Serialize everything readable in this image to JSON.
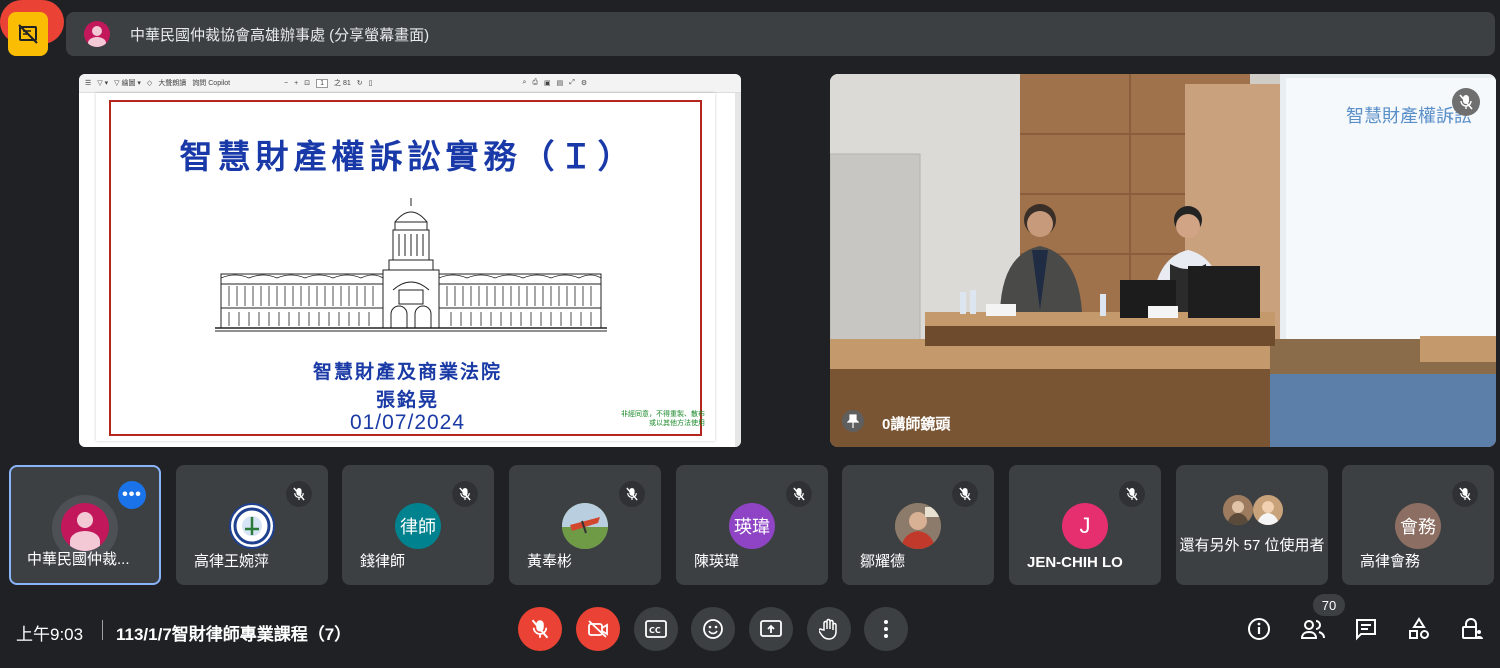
{
  "header": {
    "presenter_title": "中華民國仲裁協會高雄辦事處 (分享螢幕畫面)"
  },
  "presentation": {
    "pdf_toolbar": {
      "draw_label": "繪圖",
      "read_aloud_label": "大聲朗讀",
      "copilot_label": "詢問 Copilot",
      "page_value": "1",
      "page_total": "之 81"
    },
    "slide": {
      "title": "智慧財產權訴訟實務（Ｉ）",
      "organization": "智慧財產及商業法院",
      "author": "張銘晃",
      "date": "01/07/2024",
      "notice": "非經同意，不得重製、散布或以其他方法使用"
    }
  },
  "camera": {
    "name": "0講師鏡頭"
  },
  "participants": [
    {
      "name": "中華民國仲裁...",
      "initials": "",
      "avatar_color": "#c2185b",
      "type": "person"
    },
    {
      "name": "高律王婉萍",
      "initials": "",
      "avatar_color": "#ffffff",
      "type": "logo"
    },
    {
      "name": "錢律師",
      "initials": "律師",
      "avatar_color": "#00838f",
      "type": "initials"
    },
    {
      "name": "黃奉彬",
      "initials": "",
      "avatar_color": "#6b8e4e",
      "type": "photo"
    },
    {
      "name": "陳瑛瑋",
      "initials": "瑛瑋",
      "avatar_color": "#8e44c4",
      "type": "initials"
    },
    {
      "name": "鄒耀德",
      "initials": "",
      "avatar_color": "#7a6a5a",
      "type": "photo"
    },
    {
      "name": "JEN-CHIH LO",
      "initials": "J",
      "avatar_color": "#e52f6e",
      "type": "initials"
    },
    {
      "name": "還有另外 57 位使用者",
      "initials": "",
      "avatar_color": "#8d6e63",
      "type": "group"
    },
    {
      "name": "高律會務",
      "initials": "會務",
      "avatar_color": "#8d6e63",
      "type": "initials"
    }
  ],
  "footer": {
    "time": "上午9:03",
    "meeting_name": "113/1/7智財律師專業課程（7）",
    "participant_count": "70"
  }
}
